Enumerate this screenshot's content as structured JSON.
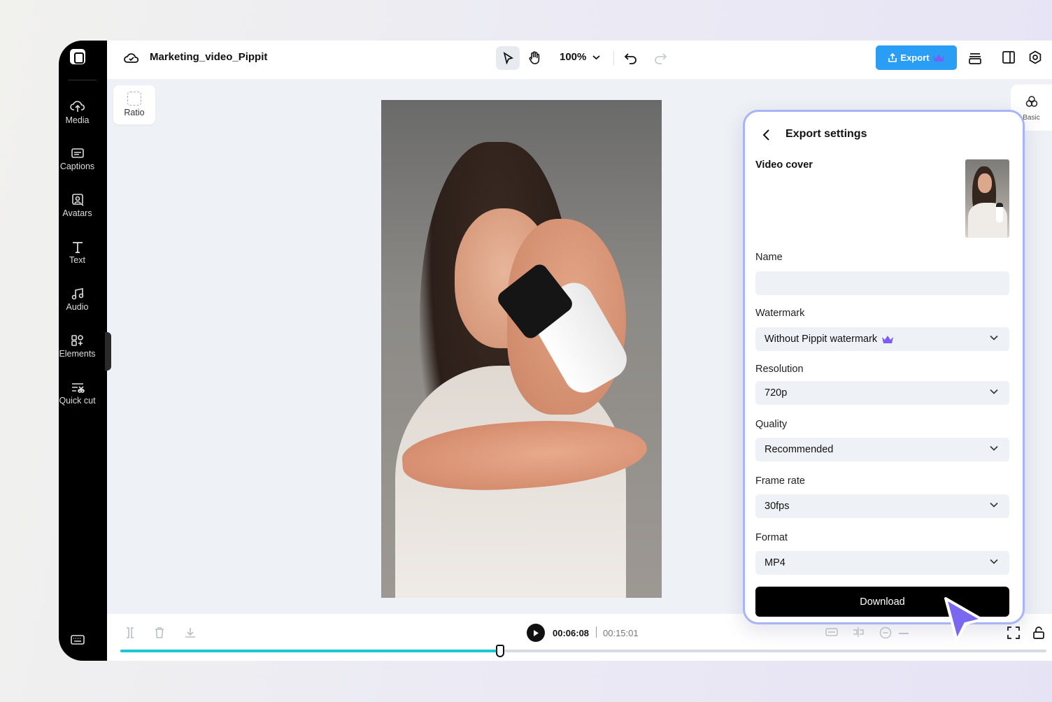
{
  "project": {
    "title": "Marketing_video_Pippit"
  },
  "toolbar": {
    "zoom": "100%",
    "export_label": "Export"
  },
  "sidebar": {
    "items": [
      {
        "label": "Media",
        "icon": "cloud-upload-icon"
      },
      {
        "label": "Captions",
        "icon": "captions-icon"
      },
      {
        "label": "Avatars",
        "icon": "avatar-icon"
      },
      {
        "label": "Text",
        "icon": "text-icon"
      },
      {
        "label": "Audio",
        "icon": "music-icon"
      },
      {
        "label": "Elements",
        "icon": "elements-icon"
      },
      {
        "label": "Quick cut",
        "icon": "quick-cut-icon"
      }
    ]
  },
  "canvas": {
    "ratio_label": "Ratio"
  },
  "right_tab": {
    "label": "Basic"
  },
  "export_panel": {
    "title": "Export settings",
    "cover_label": "Video cover",
    "name_label": "Name",
    "name_value": "",
    "watermark_label": "Watermark",
    "watermark_value": "Without Pippit watermark",
    "resolution_label": "Resolution",
    "resolution_value": "720p",
    "quality_label": "Quality",
    "quality_value": "Recommended",
    "framerate_label": "Frame rate",
    "framerate_value": "30fps",
    "format_label": "Format",
    "format_value": "MP4",
    "download_label": "Download"
  },
  "playback": {
    "current_time": "00:06:08",
    "total_time": "00:15:01",
    "progress": 0.41
  },
  "colors": {
    "accent_blue": "#2a9df4",
    "progress_cyan": "#1fc6d6",
    "panel_border": "#a9b4f7",
    "cursor_purple": "#7b68f0",
    "premium_crown": "#7b5cf5"
  }
}
